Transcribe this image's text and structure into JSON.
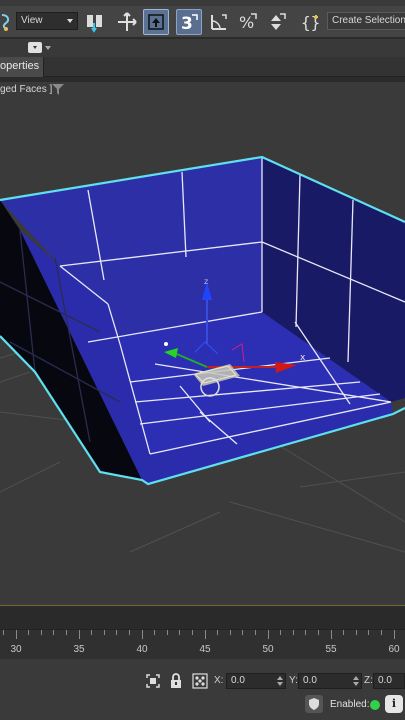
{
  "toolbar": {
    "view_dropdown": "View",
    "selection_set_field": "Create Selection S"
  },
  "command_panel": {
    "tab_label": "operties"
  },
  "viewport": {
    "label": "ged Faces ]",
    "gizmo_x_label": "x",
    "gizmo_z_label": "z"
  },
  "timeline": {
    "ruler_labels": [
      "30",
      "35",
      "40",
      "45",
      "50",
      "55",
      "60"
    ]
  },
  "status": {
    "x_label": "X:",
    "x_value": "0.0",
    "y_label": "Y:",
    "y_value": "0.0",
    "z_label": "Z:",
    "z_value": "0.0",
    "enabled_label": "Enabled:",
    "info_button": "i"
  },
  "colors": {
    "box_blue": "#2d2fa6",
    "box_edge": "#5ee0ee",
    "viewport_bg": "#3a3a3a",
    "enabled_dot": "#2fd24a"
  }
}
